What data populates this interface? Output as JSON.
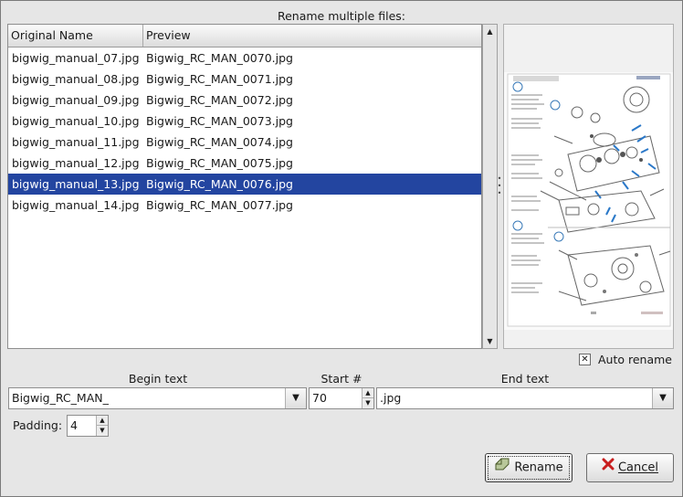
{
  "dialog": {
    "title": "Rename multiple files:",
    "auto_rename_label": "Auto rename",
    "auto_rename_checked": true
  },
  "list": {
    "columns": [
      "Original Name",
      "Preview"
    ],
    "rows": [
      {
        "original": "bigwig_manual_07.jpg",
        "preview": "Bigwig_RC_MAN_0070.jpg"
      },
      {
        "original": "bigwig_manual_08.jpg",
        "preview": "Bigwig_RC_MAN_0071.jpg"
      },
      {
        "original": "bigwig_manual_09.jpg",
        "preview": "Bigwig_RC_MAN_0072.jpg"
      },
      {
        "original": "bigwig_manual_10.jpg",
        "preview": "Bigwig_RC_MAN_0073.jpg"
      },
      {
        "original": "bigwig_manual_11.jpg",
        "preview": "Bigwig_RC_MAN_0074.jpg"
      },
      {
        "original": "bigwig_manual_12.jpg",
        "preview": "Bigwig_RC_MAN_0075.jpg"
      },
      {
        "original": "bigwig_manual_13.jpg",
        "preview": "Bigwig_RC_MAN_0076.jpg"
      },
      {
        "original": "bigwig_manual_14.jpg",
        "preview": "Bigwig_RC_MAN_0077.jpg"
      }
    ],
    "selected_index": 6
  },
  "form": {
    "begin_label": "Begin text",
    "begin_value": "Bigwig_RC_MAN_",
    "start_label": "Start #",
    "start_value": "70",
    "end_label": "End text",
    "end_value": ".jpg",
    "padding_label": "Padding:",
    "padding_value": "4"
  },
  "buttons": {
    "rename": "Rename",
    "cancel": "Cancel"
  },
  "icons": {
    "rename": "rename-icon",
    "cancel": "cancel-x-icon",
    "dropdown": "chevron-down-icon",
    "spin": "spin-arrows-icon",
    "checkbox": "check-icon"
  },
  "colors": {
    "selection": "#2345a0",
    "background": "#e6e6e6",
    "cancel_icon": "#c81e1e"
  }
}
